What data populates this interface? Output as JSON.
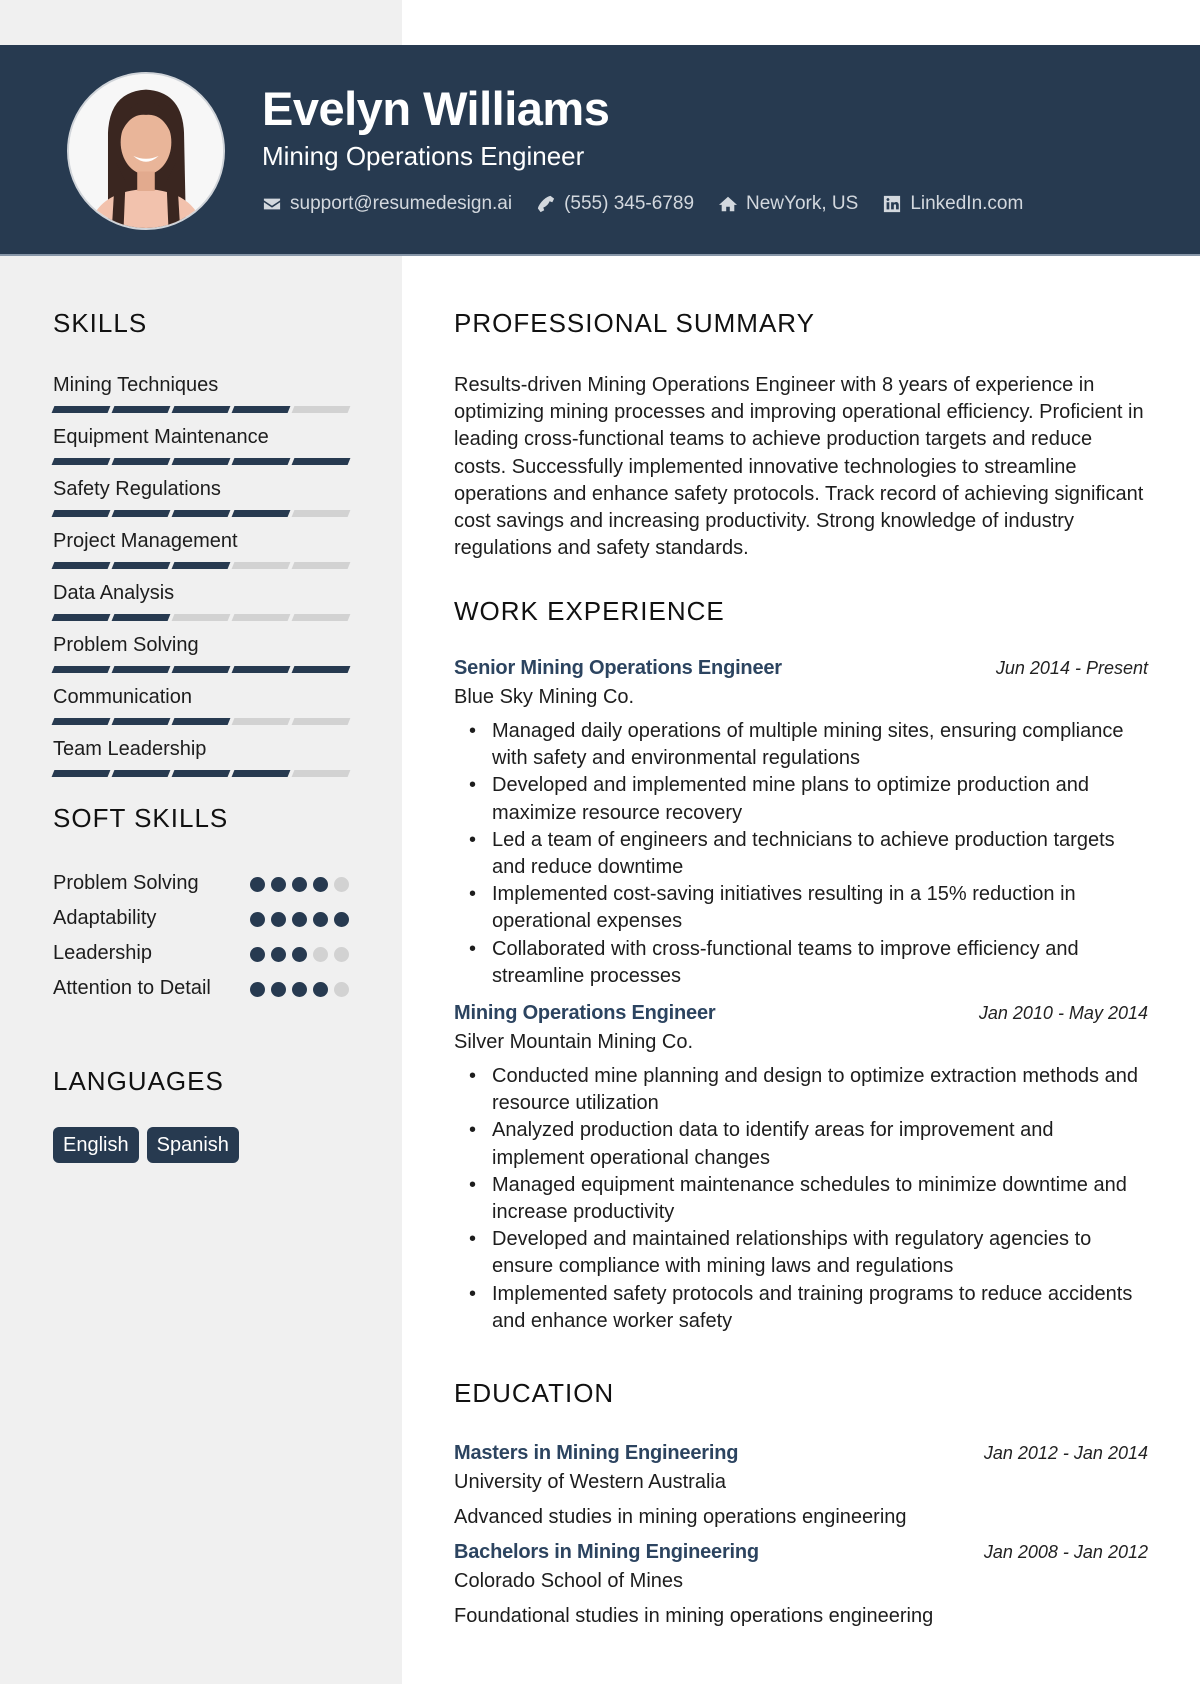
{
  "header": {
    "name": "Evelyn Williams",
    "title": "Mining Operations Engineer",
    "contacts": [
      {
        "icon": "envelope-icon",
        "text": "support@resumedesign.ai"
      },
      {
        "icon": "phone-icon",
        "text": "(555) 345-6789"
      },
      {
        "icon": "home-icon",
        "text": "NewYork, US"
      },
      {
        "icon": "linkedin-icon",
        "text": "LinkedIn.com"
      }
    ]
  },
  "sidebar": {
    "skills": {
      "title": "SKILLS",
      "items": [
        {
          "name": "Mining Techniques",
          "level": 4,
          "max": 5
        },
        {
          "name": "Equipment Maintenance",
          "level": 5,
          "max": 5
        },
        {
          "name": "Safety Regulations",
          "level": 4,
          "max": 5
        },
        {
          "name": "Project Management",
          "level": 3,
          "max": 5
        },
        {
          "name": "Data Analysis",
          "level": 2,
          "max": 5
        },
        {
          "name": "Problem Solving",
          "level": 5,
          "max": 5
        },
        {
          "name": "Communication",
          "level": 3,
          "max": 5
        },
        {
          "name": "Team Leadership",
          "level": 4,
          "max": 5
        }
      ]
    },
    "soft_skills": {
      "title": "SOFT SKILLS",
      "items": [
        {
          "name": "Problem Solving",
          "level": 4,
          "max": 5
        },
        {
          "name": "Adaptability",
          "level": 5,
          "max": 5
        },
        {
          "name": "Leadership",
          "level": 3,
          "max": 5
        },
        {
          "name": "Attention to Detail",
          "level": 4,
          "max": 5
        }
      ]
    },
    "languages": {
      "title": "LANGUAGES",
      "items": [
        "English",
        "Spanish"
      ]
    }
  },
  "main": {
    "summary": {
      "title": "PROFESSIONAL SUMMARY",
      "text": "Results-driven Mining Operations Engineer with 8 years of experience in optimizing mining processes and improving operational efficiency. Proficient in leading cross-functional teams to achieve production targets and reduce costs. Successfully implemented innovative technologies to streamline operations and enhance safety protocols. Track record of achieving significant cost savings and increasing productivity. Strong knowledge of industry regulations and safety standards."
    },
    "work": {
      "title": "WORK EXPERIENCE",
      "jobs": [
        {
          "title": "Senior Mining Operations Engineer",
          "date": "Jun 2014 - Present",
          "company": "Blue Sky Mining Co.",
          "bullets": [
            "Managed daily operations of multiple mining sites, ensuring compliance with safety and environmental regulations",
            "Developed and implemented mine plans to optimize production and maximize resource recovery",
            "Led a team of engineers and technicians to achieve production targets and reduce downtime",
            "Implemented cost-saving initiatives resulting in a 15% reduction in operational expenses",
            "Collaborated with cross-functional teams to improve efficiency and streamline processes"
          ]
        },
        {
          "title": "Mining Operations Engineer",
          "date": "Jan 2010 - May 2014",
          "company": "Silver Mountain Mining Co.",
          "bullets": [
            "Conducted mine planning and design to optimize extraction methods and resource utilization",
            "Analyzed production data to identify areas for improvement and implement operational changes",
            "Managed equipment maintenance schedules to minimize downtime and increase productivity",
            "Developed and maintained relationships with regulatory agencies to ensure compliance with mining laws and regulations",
            "Implemented safety protocols and training programs to reduce accidents and enhance worker safety"
          ]
        }
      ]
    },
    "education": {
      "title": "EDUCATION",
      "items": [
        {
          "degree": "Masters in Mining Engineering",
          "date": "Jan 2012 - Jan 2014",
          "school": "University of Western Australia",
          "desc": "Advanced studies in mining operations engineering"
        },
        {
          "degree": "Bachelors in Mining Engineering",
          "date": "Jan 2008 - Jan 2012",
          "school": "Colorado School of Mines",
          "desc": "Foundational studies in mining operations engineering"
        }
      ]
    }
  }
}
